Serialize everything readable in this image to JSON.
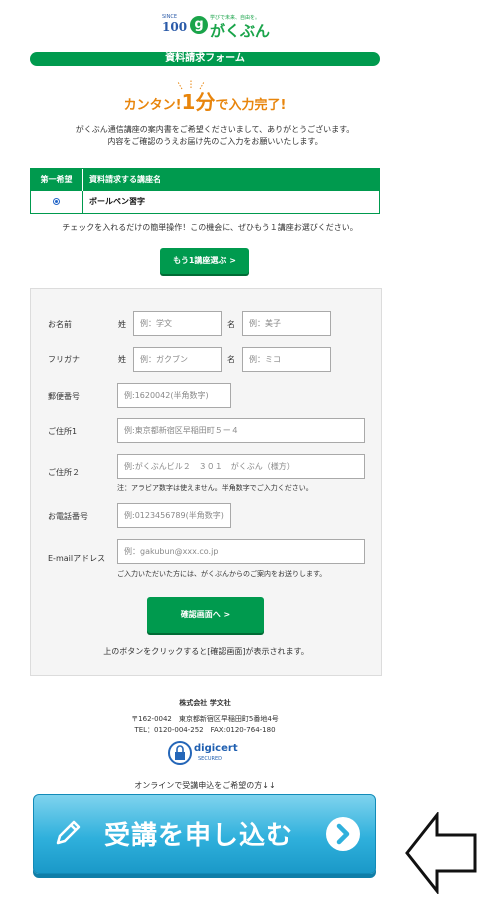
{
  "logo": {
    "badge_tiny": "SINCE",
    "badge_number": "100",
    "g_mark": "g",
    "name": "がくぶん",
    "tagline": "学びで未来、自由を。"
  },
  "title_bar": "資料請求フォーム",
  "headline": {
    "part1": "カンタン!",
    "part2": "1分",
    "part3": "で入力完了!"
  },
  "intro": {
    "line1": "がくぶん通信講座の案内書をご希望くださいまして、ありがとうございます。",
    "line2": "内容をご確認のうえお届け先のご入力をお願いいたします。"
  },
  "course_table": {
    "header_first": "第一希望",
    "header_course": "資料請求する講座名",
    "rows": [
      {
        "course": "ボールペン習字",
        "selected": true
      }
    ]
  },
  "check_note": "チェックを入れるだけの簡単操作！この機会に、ぜひもう１講座お選びください。",
  "more_button": "もう1講座選ぶ >",
  "form": {
    "name_label": "お名前",
    "sei_label": "姓",
    "mei_label": "名",
    "sei_placeholder": "例：学文",
    "mei_placeholder": "例：美子",
    "kana_label": "フリガナ",
    "kana_sei_placeholder": "例：ガクブン",
    "kana_mei_placeholder": "例：ミコ",
    "zip_label": "郵便番号",
    "zip_placeholder": "例:1620042(半角数字)",
    "addr1_label": "ご住所1",
    "addr1_placeholder": "例:東京都新宿区早稲田町５ー４",
    "addr2_label": "ご住所２",
    "addr2_placeholder": "例:がくぶんビル２　３０１　がくぶん（様方）",
    "addr_note": "注：アラビア数字は使えません。半角数字でご入力ください。",
    "tel_label": "お電話番号",
    "tel_placeholder": "例:0123456789(半角数字)",
    "email_label": "E-mailアドレス",
    "email_placeholder": "例：gakubun@xxx.co.jp",
    "email_note": "ご入力いただいた方には、がくぶんからのご案内をお送りします。",
    "confirm_button": "確認画面へ >",
    "confirm_note": "上のボタンをクリックすると[確認画面]が表示されます。"
  },
  "footer": {
    "company": "株式会社 学文社",
    "address": "〒162-0042　東京都新宿区早稲田町5番地4号",
    "phone": "TEL：0120-004-252　FAX:0120-764-180",
    "digicert_name": "digicert",
    "digicert_sub": "SECURED",
    "online_note": "オンラインで受講申込をご希望の方↓↓"
  },
  "cta": {
    "label": "受講を申し込む"
  },
  "colors": {
    "brand_green": "#009a4e",
    "headline_orange": "#e8850c",
    "cta_blue": "#2fb0dc"
  },
  "icons": [
    "pencil-icon",
    "chevron-right-icon",
    "digicert-lock-icon",
    "left-arrow-icon",
    "sparkle-icon"
  ]
}
